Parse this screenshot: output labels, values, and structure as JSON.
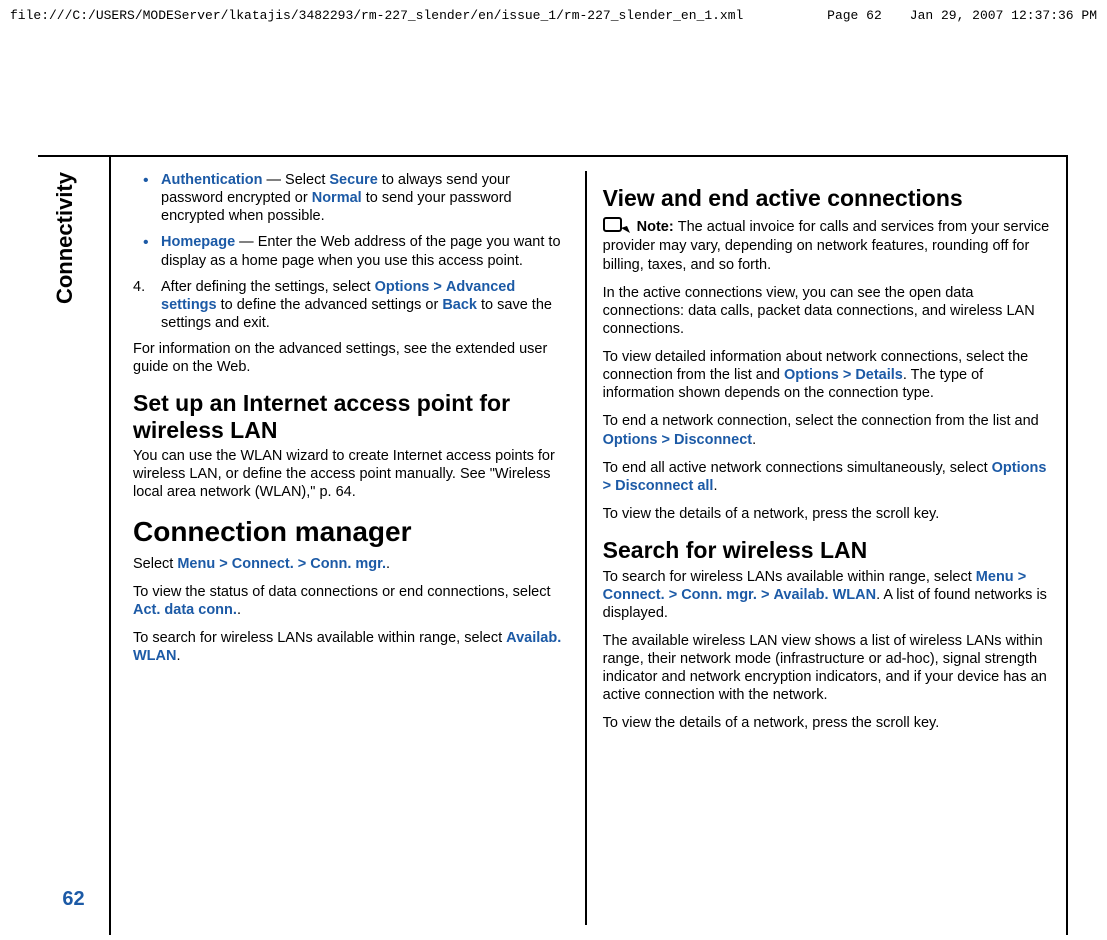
{
  "header": {
    "path": "file:///C:/USERS/MODEServer/lkatajis/3482293/rm-227_slender/en/issue_1/rm-227_slender_en_1.xml",
    "page": "Page 62",
    "datetime": "Jan 29, 2007 12:37:36 PM"
  },
  "sidebar": {
    "topic": "Connectivity",
    "page_number": "62"
  },
  "left": {
    "bullets": [
      {
        "term": "Authentication",
        "sep": " — Select ",
        "opt1": "Secure",
        "mid": " to always send your password encrypted or ",
        "opt2": "Normal",
        "tail": " to send your password encrypted when possible."
      },
      {
        "term": "Homepage",
        "sep": " — Enter the Web address of the page you want to display as a home page when you use this access point."
      }
    ],
    "step4": {
      "num": "4.",
      "t1": "After defining the settings, select ",
      "k1": "Options",
      "caret1": ">",
      "k2": "Advanced settings",
      "t2": " to define the advanced settings or ",
      "k3": "Back",
      "t3": " to save the settings and exit."
    },
    "advinfo": "For information on the advanced settings, see the extended user guide on the Web.",
    "h2_setup": "Set up an Internet access point for wireless LAN",
    "setup_p": "You can use the WLAN wizard to create Internet access points for wireless LAN, or define the access point manually. See \"Wireless local area network (WLAN),\" p. 64.",
    "h1_connmgr": "Connection manager",
    "cm1": {
      "t1": "Select ",
      "k1": "Menu",
      "c1": ">",
      "k2": "Connect.",
      "c2": ">",
      "k3": "Conn. mgr.",
      "end": "."
    },
    "cm2": {
      "t1": "To view the status of data connections or end connections, select ",
      "k1": "Act. data conn.",
      "end": "."
    },
    "cm3": {
      "t1": "To search for wireless LANs available within range, select ",
      "k1": "Availab. WLAN",
      "end": "."
    }
  },
  "right": {
    "h2_view": "View and end active connections",
    "note": {
      "label": "Note:  ",
      "text": "The actual invoice for calls and services from your service provider may vary, depending on network features, rounding off for billing, taxes, and so forth."
    },
    "p_open": "In the active connections view, you can see the open data connections: data calls, packet data connections, and wireless LAN connections.",
    "p_detail": {
      "t1": "To view detailed information about network connections, select the connection from the list and ",
      "k1": "Options",
      "c1": ">",
      "k2": "Details",
      "t2": ". The type of information shown depends on the connection type."
    },
    "p_end1": {
      "t1": "To end a network connection, select the connection from the list and ",
      "k1": "Options",
      "c1": ">",
      "k2": "Disconnect",
      "end": "."
    },
    "p_end2": {
      "t1": "To end all active network connections simultaneously, select ",
      "k1": "Options",
      "c1": ">",
      "k2": "Disconnect all",
      "end": "."
    },
    "p_scroll": "To view the details of a network, press the scroll key.",
    "h2_search": "Search for wireless LAN",
    "p_search": {
      "t1": "To search for wireless LANs available within range, select ",
      "k1": "Menu",
      "c1": ">",
      "k2": "Connect.",
      "c2": ">",
      "k3": "Conn. mgr.",
      "c3": ">",
      "k4": "Availab. WLAN",
      "t2": ". A list of found networks is displayed."
    },
    "p_listdesc": "The available wireless LAN view shows a list of wireless LANs within range, their network mode (infrastructure or ad-hoc), signal strength indicator and network encryption indicators, and if your device has an active connection with the network.",
    "p_scroll2": "To view the details of a network, press the scroll key."
  }
}
